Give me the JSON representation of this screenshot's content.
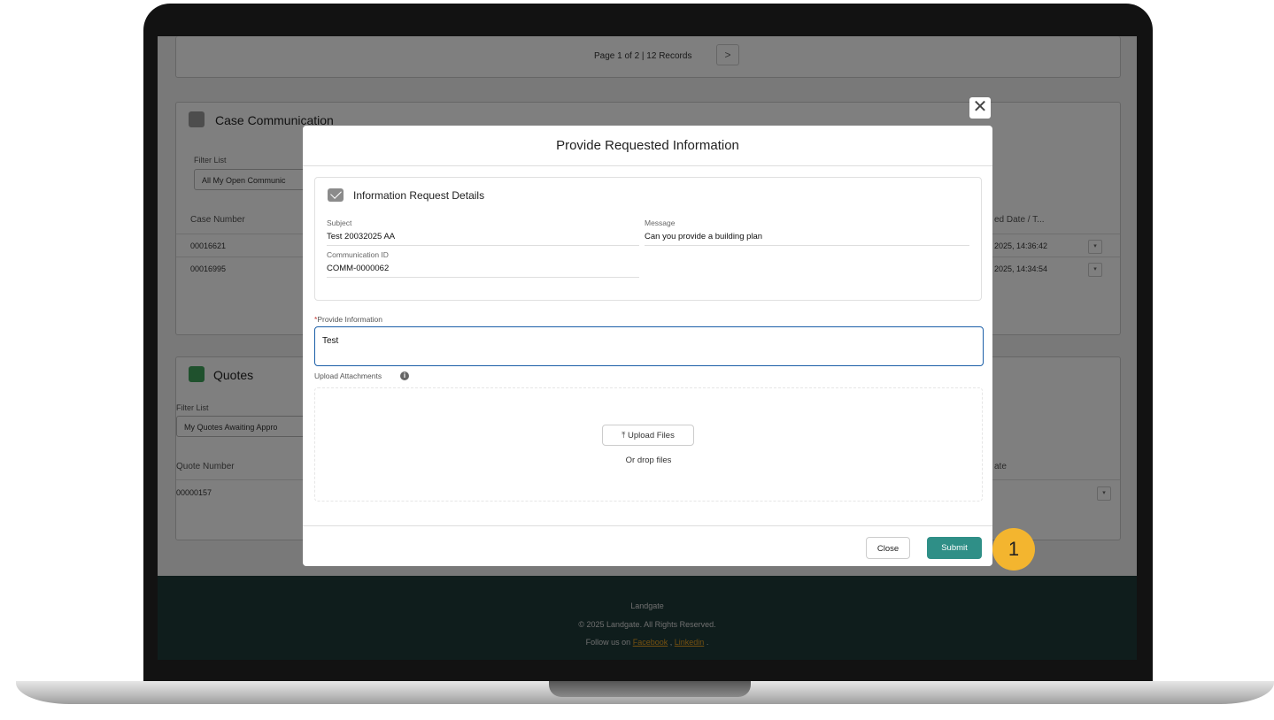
{
  "background": {
    "pager_text": "Page 1 of 2 | 12 Records",
    "pager_next": ">",
    "case_comm": {
      "title": "Case Communication",
      "filter_label": "Filter List",
      "filter_value": "All My Open Communic",
      "headers": {
        "case_number": "Case Number",
        "last_col": "ed Date / T..."
      },
      "rows": [
        {
          "case_number": "00016621",
          "date": "2025, 14:36:42"
        },
        {
          "case_number": "00016995",
          "date": "2025, 14:34:54"
        }
      ]
    },
    "quotes": {
      "title": "Quotes",
      "filter_label": "Filter List",
      "filter_value": "My Quotes Awaiting Appro",
      "headers": {
        "quote_number": "Quote Number",
        "last_col": "ate"
      },
      "rows": [
        {
          "quote_number": "00000157"
        }
      ]
    },
    "footer": {
      "brand": "Landgate",
      "copyright": "© 2025 Landgate. All Rights Reserved.",
      "follow_prefix": "Follow us on",
      "facebook": "Facebook",
      "linkedin": "Linkedin",
      "sep": ",",
      "end": "."
    }
  },
  "modal": {
    "close_x": "✕",
    "title": "Provide Requested Information",
    "details": {
      "title": "Information Request Details",
      "subject_label": "Subject",
      "subject_value": "Test 20032025 AA",
      "message_label": "Message",
      "message_value": "Can you provide a building plan",
      "comm_id_label": "Communication ID",
      "comm_id_value": "COMM-0000062"
    },
    "provide_info": {
      "required_mark": "*",
      "label": "Provide Information",
      "value": "Test"
    },
    "upload": {
      "label": "Upload Attachments",
      "button": "Upload Files",
      "drop_text": "Or drop files"
    },
    "close_button": "Close",
    "submit_button": "Submit"
  },
  "annotation": {
    "step": "1"
  },
  "colors": {
    "submit": "#2f8f87",
    "focus_border": "#1b5fa8",
    "footer_bg": "#1e3a38",
    "badge": "#f3b52f"
  }
}
